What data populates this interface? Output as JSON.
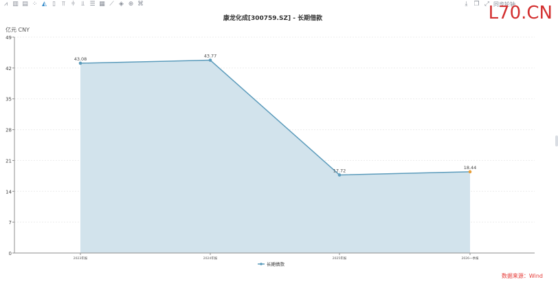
{
  "toolbar": {
    "icons": [
      "line-chart-icon",
      "bar-chart-icon",
      "stacked-bar-icon",
      "scatter-icon",
      "area-chart-icon",
      "column-icon",
      "align-top-icon",
      "align-middle-icon",
      "align-bottom-icon",
      "list-icon",
      "table-icon",
      "trend-icon",
      "fill-icon",
      "zoom-icon",
      "tag-icon"
    ],
    "right_label": "同步轮轴",
    "right_icons": [
      "download-icon",
      "copy-icon",
      "expand-icon"
    ]
  },
  "watermark": "L70.CN",
  "source_label": "数据来源：Wind",
  "colors": {
    "line": "#5b9bbb",
    "area": "#d2e3ec",
    "last_point": "#e8a03a",
    "axis": "#8c8c8c",
    "grid": "#ececec"
  },
  "chart_data": {
    "type": "area",
    "title": "康龙化成[300759.SZ] - 长期借款",
    "unit_label": "亿元  CNY",
    "categories": [
      "2023年报",
      "2024年报",
      "2025年报",
      "2026一季报"
    ],
    "series": [
      {
        "name": "长期借款",
        "values": [
          43.08,
          43.77,
          17.72,
          18.44
        ],
        "labels": [
          "43.08",
          "43.77",
          "17.72",
          "18.44"
        ]
      }
    ],
    "yticks": [
      0,
      7,
      14,
      21,
      28,
      35,
      42,
      49
    ],
    "ylim": [
      0,
      49
    ],
    "grid": true,
    "legend": "bottom-center"
  }
}
